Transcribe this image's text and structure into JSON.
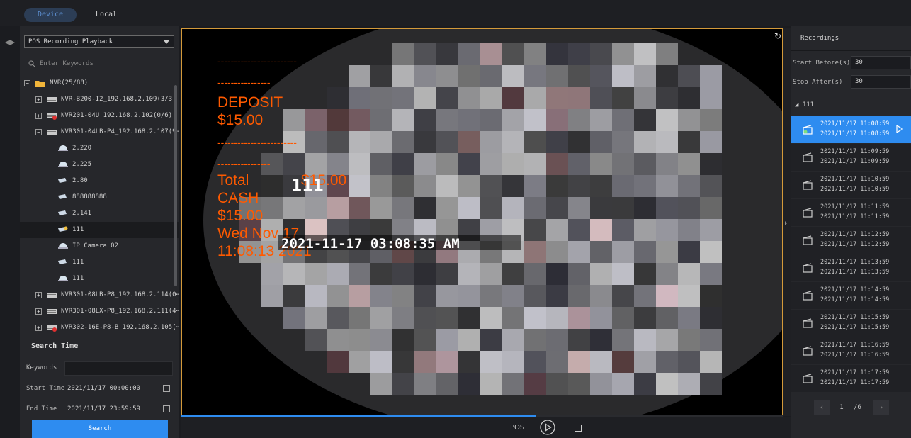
{
  "top_tabs": {
    "device": "Device",
    "local": "Local"
  },
  "left": {
    "mode": "POS Recording Playback",
    "search_placeholder": "Enter Keywords",
    "tree": [
      {
        "label": "NVR(25/88)",
        "type": "folder",
        "toggle": "−",
        "indent": 0
      },
      {
        "label": "NVR-B200-I2_192.168.2.109(3/3)",
        "type": "nvr",
        "toggle": "+",
        "indent": 1
      },
      {
        "label": "NVR201-04U_192.168.2.102(0/6)",
        "type": "nvr-offline",
        "toggle": "+",
        "indent": 1
      },
      {
        "label": "NVR301-04LB-P4_192.168.2.107(9⋯",
        "type": "nvr",
        "toggle": "−",
        "indent": 1
      },
      {
        "label": "2.220",
        "type": "dome",
        "indent": 2
      },
      {
        "label": "2.225",
        "type": "dome",
        "indent": 2
      },
      {
        "label": "2.80",
        "type": "bullet",
        "indent": 2
      },
      {
        "label": "888888888",
        "type": "bullet",
        "indent": 2
      },
      {
        "label": "2.141",
        "type": "bullet",
        "indent": 2
      },
      {
        "label": "111",
        "type": "bullet-active",
        "indent": 2,
        "selected": true
      },
      {
        "label": "IP Camera 02",
        "type": "dome",
        "indent": 2
      },
      {
        "label": "111",
        "type": "bullet",
        "indent": 2
      },
      {
        "label": "111",
        "type": "dome",
        "indent": 2
      },
      {
        "label": "NVR301-08LB-P8_192.168.2.114(0⋯",
        "type": "nvr",
        "toggle": "+",
        "indent": 1
      },
      {
        "label": "NVR301-08LX-P8_192.168.2.111(4⋯",
        "type": "nvr",
        "toggle": "+",
        "indent": 1
      },
      {
        "label": "NVR302-16E-P8-B_192.168.2.105(⋯",
        "type": "nvr-offline",
        "toggle": "+",
        "indent": 1
      }
    ],
    "search_time": {
      "title": "Search Time",
      "keywords_label": "Keywords",
      "keywords_value": "",
      "start_label": "Start Time",
      "start_value": "2021/11/17 00:00:00",
      "end_label": "End Time",
      "end_value": "2021/11/17 23:59:59",
      "button": "Search"
    }
  },
  "video": {
    "pos_lines": [
      "------------------------",
      "----------------",
      "DEPOSIT",
      "$15.00",
      "------------------------",
      "----------------",
      "Total",
      "$15.00",
      "CASH",
      "$15.00",
      "Wed Nov 17",
      "11:08:13 2021"
    ],
    "osd_time": "2021-11-17 03:08:35 AM",
    "osd_name": "111",
    "progress": 0.59
  },
  "bottom": {
    "pos_label": "POS"
  },
  "right": {
    "title": "Recordings",
    "start_before_label": "Start Before(s)",
    "start_before_value": "30",
    "stop_after_label": "Stop After(s)",
    "stop_after_value": "30",
    "group": "111",
    "recordings": [
      {
        "start": "2021/11/17  11:08:59",
        "end": "2021/11/17  11:08:59",
        "selected": true
      },
      {
        "start": "2021/11/17  11:09:59",
        "end": "2021/11/17  11:09:59"
      },
      {
        "start": "2021/11/17  11:10:59",
        "end": "2021/11/17  11:10:59"
      },
      {
        "start": "2021/11/17  11:11:59",
        "end": "2021/11/17  11:11:59"
      },
      {
        "start": "2021/11/17  11:12:59",
        "end": "2021/11/17  11:12:59"
      },
      {
        "start": "2021/11/17  11:13:59",
        "end": "2021/11/17  11:13:59"
      },
      {
        "start": "2021/11/17  11:14:59",
        "end": "2021/11/17  11:14:59"
      },
      {
        "start": "2021/11/17  11:15:59",
        "end": "2021/11/17  11:15:59"
      },
      {
        "start": "2021/11/17  11:16:59",
        "end": "2021/11/17  11:16:59"
      },
      {
        "start": "2021/11/17  11:17:59",
        "end": "2021/11/17  11:17:59"
      }
    ],
    "pager": {
      "current": "1",
      "total": "/6"
    }
  },
  "colors": {
    "accent": "#2e8cf0",
    "pos_text": "#ff5a00",
    "border_highlight": "#d49a3a"
  }
}
